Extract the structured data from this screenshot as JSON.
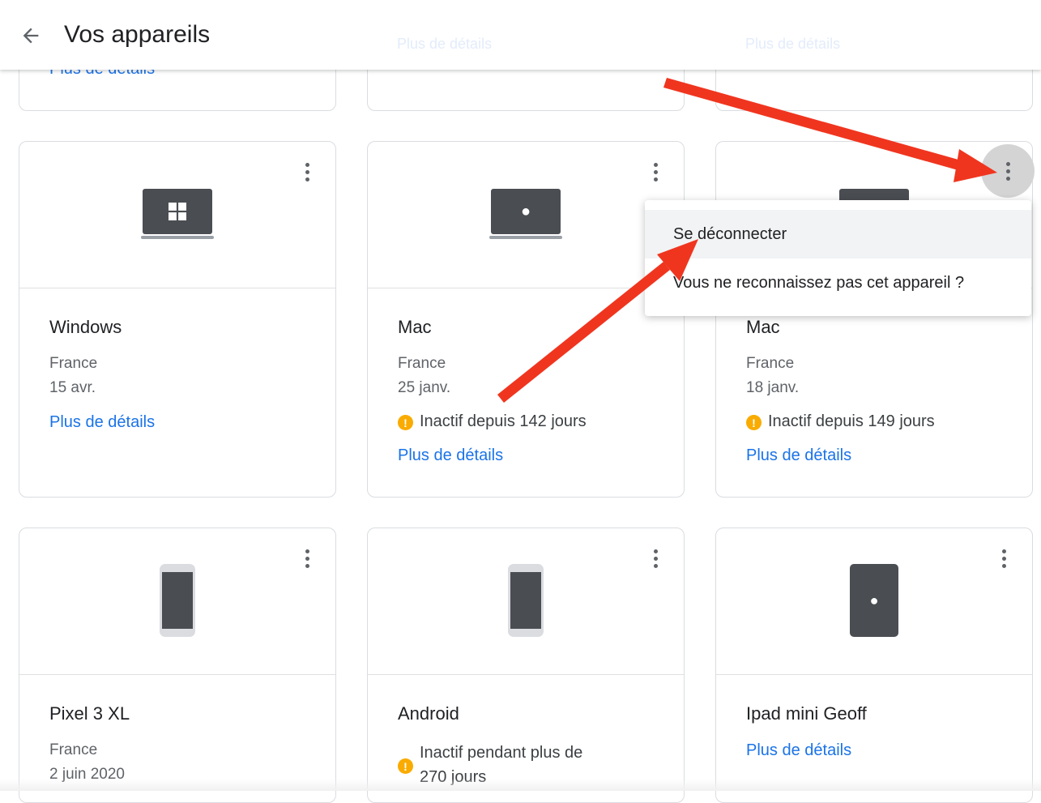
{
  "header": {
    "title": "Vos appareils",
    "peek_texts": [
      "Plus de détails",
      "Plus de détails",
      "Plus de détails"
    ]
  },
  "devices": [
    {
      "name": "Windows",
      "location": "France",
      "date": "15 avr.",
      "status": "",
      "link": "Plus de détails",
      "icon": "windows-laptop-icon"
    },
    {
      "name": "Mac",
      "location": "France",
      "date": "25 janv.",
      "status": "Inactif depuis 142 jours",
      "link": "Plus de détails",
      "icon": "mac-laptop-icon"
    },
    {
      "name": "Mac",
      "location": "France",
      "date": "18 janv.",
      "status": "Inactif depuis 149 jours",
      "link": "Plus de détails",
      "icon": "mac-laptop-icon"
    },
    {
      "name": "Pixel 3 XL",
      "location": "France",
      "date": "2 juin 2020",
      "status": "",
      "link": "",
      "icon": "phone-icon"
    },
    {
      "name": "Android",
      "location": "",
      "date": "",
      "status": "Inactif pendant plus de 270 jours",
      "link": "",
      "icon": "phone-icon"
    },
    {
      "name": "Ipad mini Geoff",
      "location": "",
      "date": "",
      "status": "",
      "link": "Plus de détails",
      "icon": "ipad-icon"
    }
  ],
  "menu": {
    "items": [
      "Se déconnecter",
      "Vous ne reconnaissez pas cet appareil ?"
    ]
  },
  "colors": {
    "link": "#1a73e8",
    "warning": "#f9ab00",
    "annotation_arrow": "#f0351f"
  }
}
